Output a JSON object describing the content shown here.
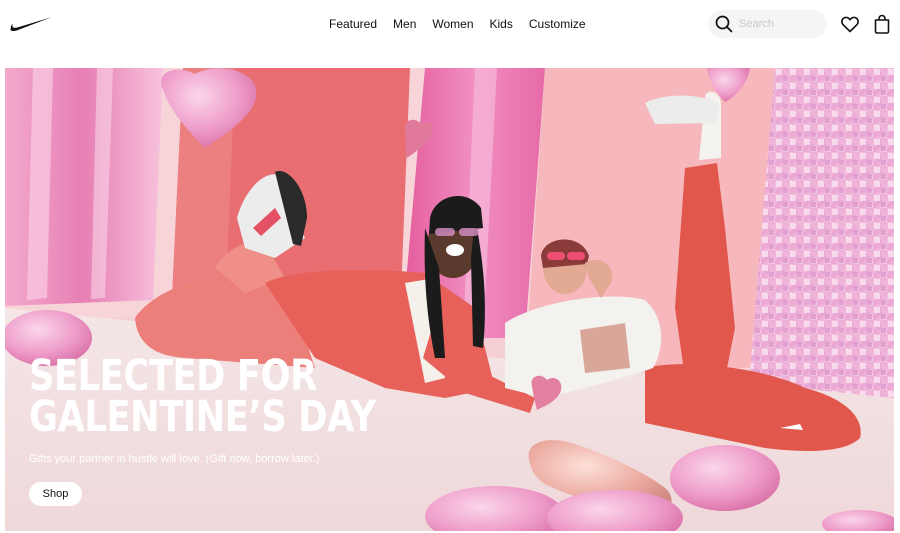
{
  "header": {
    "logo": "nike-swoosh",
    "nav": [
      {
        "label": "Featured"
      },
      {
        "label": "Men"
      },
      {
        "label": "Women"
      },
      {
        "label": "Kids"
      },
      {
        "label": "Customize"
      }
    ],
    "search": {
      "placeholder": "Search",
      "icon": "search-icon"
    },
    "favorites_icon": "heart-icon",
    "bag_icon": "bag-icon"
  },
  "hero": {
    "headline_line1": "SELECTED FOR",
    "headline_line2": "GALENTINE’S DAY",
    "subtitle": "Gifts your partner in hustle will love. (Gift now, borrow later.)",
    "cta_label": "Shop",
    "colors": {
      "background": "#f6cfd4",
      "accent_red": "#e0594f",
      "accent_pink": "#f08ab4"
    }
  }
}
